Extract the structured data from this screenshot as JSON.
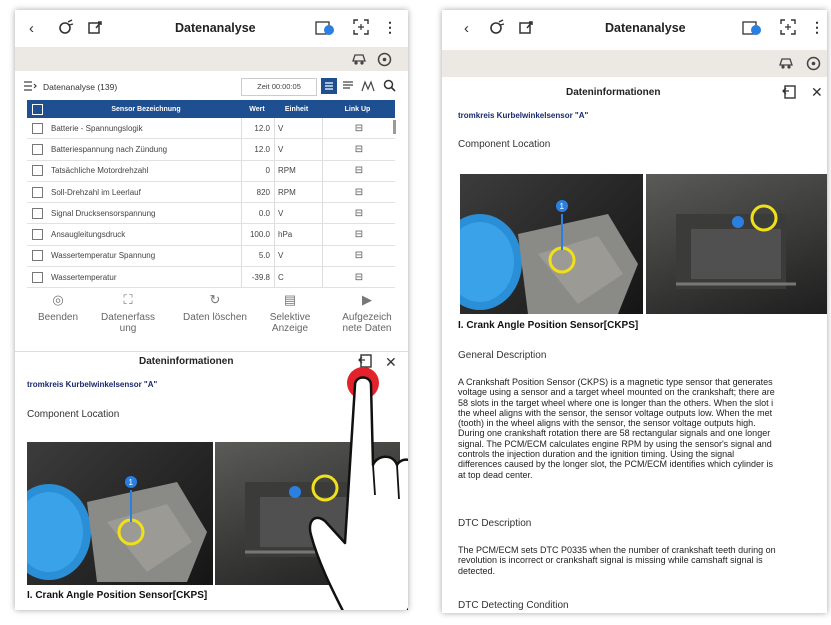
{
  "colors": {
    "header_blue": "#1d4f91",
    "gray_bar": "#ece8e3",
    "touch_red": "#e3232c",
    "circle_yellow": "#f0e01a",
    "marker_blue": "#2a7fe0"
  },
  "left": {
    "title": "Datenanalyse",
    "list_title": "Datenanalyse (139)",
    "time_label": "Zeit 00:00:05",
    "table": {
      "headers": [
        "Sensor Bezeichnung",
        "Wert",
        "Einheit",
        "Link Up"
      ],
      "rows": [
        {
          "name": "Batterie - Spannungslogik",
          "value": "12.0",
          "unit": "V"
        },
        {
          "name": "Batteriespannung nach Zündung",
          "value": "12.0",
          "unit": "V"
        },
        {
          "name": "Tatsächliche Motordrehzahl",
          "value": "0",
          "unit": "RPM"
        },
        {
          "name": "Soll-Drehzahl im Leerlauf",
          "value": "820",
          "unit": "RPM"
        },
        {
          "name": "Signal Drucksensorspannung",
          "value": "0.0",
          "unit": "V"
        },
        {
          "name": "Ansaugleitungsdruck",
          "value": "100.0",
          "unit": "hPa"
        },
        {
          "name": "Wassertemperatur Spannung",
          "value": "5.0",
          "unit": "V"
        },
        {
          "name": "Wassertemperatur",
          "value": "-39.8",
          "unit": "C"
        }
      ]
    },
    "actions": [
      {
        "label": "Beenden"
      },
      {
        "label": "Datenerfassung"
      },
      {
        "label": "Daten löschen"
      },
      {
        "label": "Selektive Anzeige"
      },
      {
        "label": "Aufgezeichnete Daten"
      }
    ],
    "info_title": "Dateninformationen",
    "circuit_title": "tromkreis Kurbelwinkelsensor \"A\"",
    "component_location": "Component Location",
    "caption": "I. Crank Angle Position Sensor[CKPS]"
  },
  "right": {
    "title": "Datenanalyse",
    "info_title": "Dateninformationen",
    "circuit_title": "tromkreis Kurbelwinkelsensor \"A\"",
    "component_location": "Component Location",
    "caption": "I. Crank Angle Position Sensor[CKPS]",
    "general_title": "General Description",
    "general_lines": [
      "A Crankshaft Position Sensor (CKPS) is a magnetic type sensor that generates",
      "voltage using a sensor and a target wheel mounted on the crankshaft; there are",
      "58 slots in the target wheel where one is longer than the others. When the slot i",
      "the wheel aligns with the sensor, the sensor voltage outputs low. When the met",
      "(tooth) in the wheel aligns with the sensor, the sensor voltage outputs high.",
      "During one crankshaft rotation there are 58 rectangular signals and one longer",
      "signal. The PCM/ECM calculates engine RPM by using the sensor's signal and",
      "controls the injection duration and the ignition timing. Using the signal",
      "differences caused by the longer slot, the PCM/ECM identifies which cylinder is",
      "at top dead center."
    ],
    "dtc_title": "DTC Description",
    "dtc_lines": [
      "The PCM/ECM sets DTC P0335 when the number of crankshaft teeth during on",
      "revolution is incorrect or crankshaft signal is missing while camshaft signal is",
      "detected."
    ],
    "detecting_title": "DTC Detecting Condition"
  },
  "icons": {
    "back": "chevron-left-icon",
    "vci": "vci-icon",
    "exit": "exit-icon",
    "connect": "connect-icon",
    "screenshot": "screenshot-icon",
    "menu": "more-vert-icon",
    "car": "car-icon",
    "steering": "steering-icon"
  }
}
